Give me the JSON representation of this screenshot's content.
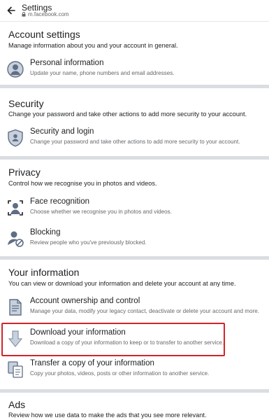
{
  "header": {
    "title": "Settings",
    "url": "m.facebook.com",
    "back_icon": "arrow-left-icon",
    "lock_icon": "lock-icon"
  },
  "sections": {
    "account": {
      "title": "Account settings",
      "desc": "Manage information about you and your account in general.",
      "items": [
        {
          "title": "Personal information",
          "desc": "Update your name, phone numbers and email addresses.",
          "icon": "person-icon"
        }
      ]
    },
    "security": {
      "title": "Security",
      "desc": "Change your password and take other actions to add more security to your account.",
      "items": [
        {
          "title": "Security and login",
          "desc": "Change your password and take other actions to add more security to your account.",
          "icon": "shield-icon"
        }
      ]
    },
    "privacy": {
      "title": "Privacy",
      "desc": "Control how we recognise you in photos and videos.",
      "items": [
        {
          "title": "Face recognition",
          "desc": "Choose whether we recognise you in photos and videos.",
          "icon": "face-scan-icon"
        },
        {
          "title": "Blocking",
          "desc": "Review people who you've previously blocked.",
          "icon": "blocked-person-icon"
        }
      ]
    },
    "your_info": {
      "title": "Your information",
      "desc": "You can view or download your information and delete your account at any time.",
      "items": [
        {
          "title": "Account ownership and control",
          "desc": "Manage your data, modify your legacy contact, deactivate or delete your account and more.",
          "icon": "document-icon"
        },
        {
          "title": "Download your information",
          "desc": "Download a copy of your information to keep or to transfer to another service.",
          "icon": "download-arrow-icon"
        },
        {
          "title": "Transfer a copy of your information",
          "desc": "Copy your photos, videos, posts or other information to another service.",
          "icon": "transfer-icon"
        }
      ]
    },
    "ads": {
      "title": "Ads",
      "desc": "Review how we use data to make the ads that you see more relevant."
    }
  },
  "colors": {
    "highlight": "#d2232a",
    "divider": "#dadde1",
    "icon_fill": "#5f6e84",
    "icon_light": "#c7d0dd"
  }
}
